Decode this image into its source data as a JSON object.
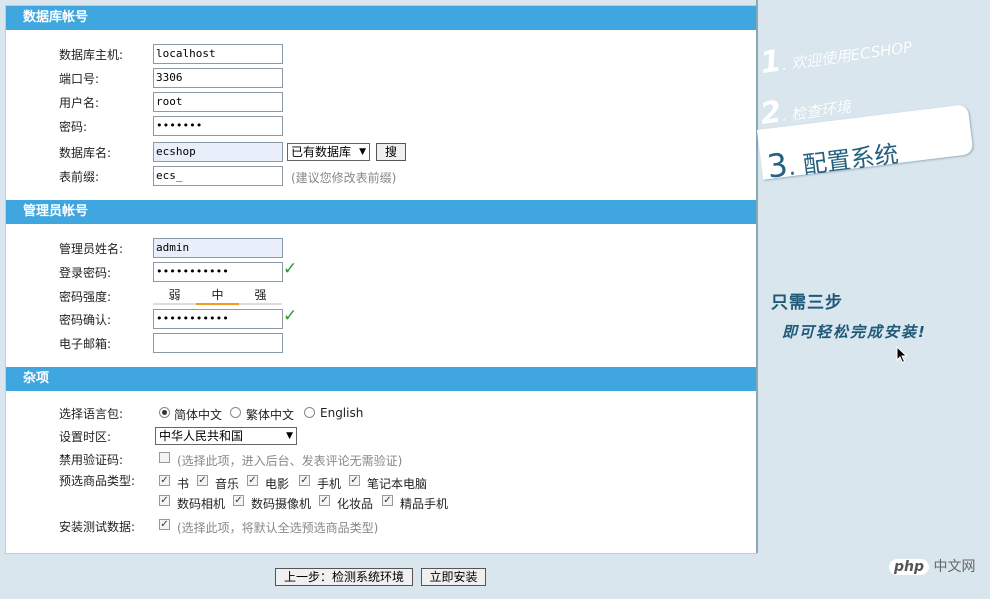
{
  "db_section": {
    "title": "数据库帐号",
    "host_label": "数据库主机:",
    "host_value": "localhost",
    "port_label": "端口号:",
    "port_value": "3306",
    "user_label": "用户名:",
    "user_value": "root",
    "pass_label": "密码:",
    "pass_value": "•••••••",
    "dbname_label": "数据库名:",
    "dbname_value": "ecshop",
    "existing_db_select": "已有数据库",
    "search_button": "搜",
    "prefix_label": "表前缀:",
    "prefix_value": "ecs_",
    "prefix_hint": "(建议您修改表前缀)"
  },
  "admin_section": {
    "title": "管理员帐号",
    "name_label": "管理员姓名:",
    "name_value": "admin",
    "pass_label": "登录密码:",
    "pass_value": "•••••••••••",
    "strength_label": "密码强度:",
    "strength_weak": "弱",
    "strength_mid": "中",
    "strength_strong": "强",
    "confirm_label": "密码确认:",
    "confirm_value": "•••••••••••",
    "email_label": "电子邮箱:"
  },
  "misc_section": {
    "title": "杂项",
    "lang_label": "选择语言包:",
    "lang_options": [
      "简体中文",
      "繁体中文",
      "English"
    ],
    "tz_label": "设置时区:",
    "tz_value": "中华人民共和国",
    "captcha_label": "禁用验证码:",
    "captcha_hint": "(选择此项，进入后台、发表评论无需验证)",
    "goods_label": "预选商品类型:",
    "goods_types": [
      "书",
      "音乐",
      "电影",
      "手机",
      "笔记本电脑",
      "数码相机",
      "数码摄像机",
      "化妆品",
      "精品手机"
    ],
    "testdata_label": "安装测试数据:",
    "testdata_hint": "(选择此项，将默认全选预选商品类型)"
  },
  "buttons": {
    "prev": "上一步：检测系统环境",
    "install": "立即安装"
  },
  "steps": {
    "s1_num": "1",
    "s1_text": ". 欢迎使用ECSHOP",
    "s2_num": "2",
    "s2_text": ". 检查环境",
    "s3_num": "3",
    "s3_text": ". 配置系统"
  },
  "slogan": {
    "line1": "只需三步",
    "line2": "即可轻松完成安装!"
  },
  "watermark": {
    "logo": "php",
    "text": "中文网"
  },
  "colors": {
    "header": "#3fa6e0",
    "accent": "#f39a1e",
    "check": "#2a9a2a",
    "side_bg": "#d9e6ee"
  }
}
